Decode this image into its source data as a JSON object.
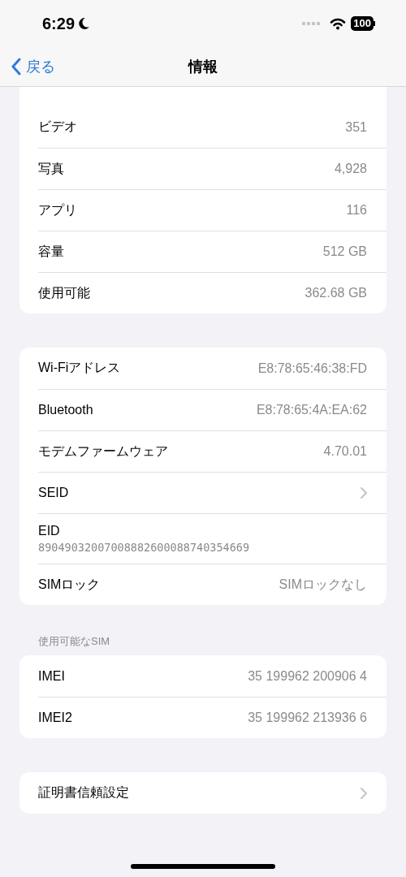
{
  "status_bar": {
    "time": "6:29",
    "battery": "100"
  },
  "nav": {
    "back": "戻る",
    "title": "情報"
  },
  "sections": [
    {
      "rows": [
        {
          "kind": "value",
          "label": "ビデオ",
          "value": "351"
        },
        {
          "kind": "value",
          "label": "写真",
          "value": "4,928"
        },
        {
          "kind": "value",
          "label": "アプリ",
          "value": "116"
        },
        {
          "kind": "value",
          "label": "容量",
          "value": "512 GB"
        },
        {
          "kind": "value",
          "label": "使用可能",
          "value": "362.68 GB"
        }
      ]
    },
    {
      "rows": [
        {
          "kind": "value",
          "label": "Wi-Fiアドレス",
          "value": "E8:78:65:46:38:FD"
        },
        {
          "kind": "value",
          "label": "Bluetooth",
          "value": "E8:78:65:4A:EA:62"
        },
        {
          "kind": "value",
          "label": "モデムファームウェア",
          "value": "4.70.01"
        },
        {
          "kind": "link",
          "label": "SEID"
        },
        {
          "kind": "stacked",
          "label": "EID",
          "value": "89049032007008882600088740354669"
        },
        {
          "kind": "value",
          "label": "SIMロック",
          "value": "SIMロックなし"
        }
      ]
    },
    {
      "header": "使用可能なSIM",
      "rows": [
        {
          "kind": "value",
          "label": "IMEI",
          "value": "35 199962 200906 4"
        },
        {
          "kind": "value",
          "label": "IMEI2",
          "value": "35 199962 213936 6"
        }
      ]
    },
    {
      "rows": [
        {
          "kind": "link",
          "label": "証明書信頼設定"
        }
      ]
    }
  ]
}
